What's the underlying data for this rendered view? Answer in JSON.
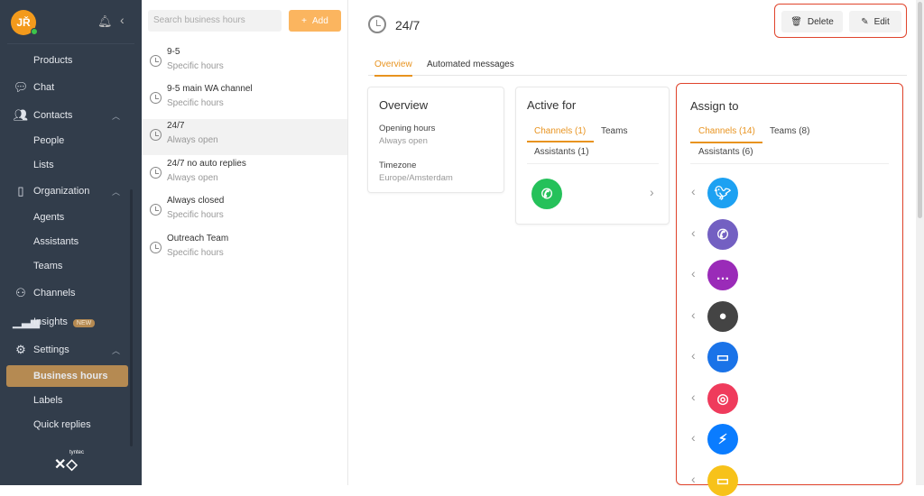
{
  "user": {
    "initials": "JŘ"
  },
  "sidebar": {
    "items": [
      {
        "label": "Products",
        "icon": "none"
      },
      {
        "label": "Chat",
        "icon": "chat-icon"
      },
      {
        "label": "Contacts",
        "icon": "contacts-icon"
      },
      {
        "label": "People"
      },
      {
        "label": "Lists"
      },
      {
        "label": "Organization",
        "icon": "building-icon"
      },
      {
        "label": "Agents"
      },
      {
        "label": "Assistants"
      },
      {
        "label": "Teams"
      },
      {
        "label": "Channels",
        "icon": "channels-icon"
      },
      {
        "label": "Insights",
        "icon": "bar-chart-icon",
        "badge": "NEW"
      },
      {
        "label": "Settings",
        "icon": "gear-icon"
      },
      {
        "label": "Business hours",
        "active": true
      },
      {
        "label": "Labels"
      },
      {
        "label": "Quick replies"
      }
    ],
    "logo": "tyntec"
  },
  "list": {
    "search_placeholder": "Search business hours",
    "add_label": "Add",
    "items": [
      {
        "title": "9-5",
        "subtitle": "Specific hours"
      },
      {
        "title": "9-5 main WA channel",
        "subtitle": "Specific hours"
      },
      {
        "title": "24/7",
        "subtitle": "Always open",
        "selected": true
      },
      {
        "title": "24/7 no auto replies",
        "subtitle": "Always open"
      },
      {
        "title": "Always closed",
        "subtitle": "Specific hours"
      },
      {
        "title": "Outreach Team",
        "subtitle": "Specific hours"
      }
    ]
  },
  "detail": {
    "title": "24/7",
    "delete_label": "Delete",
    "edit_label": "Edit",
    "tabs": [
      "Overview",
      "Automated messages"
    ],
    "overview": {
      "title": "Overview",
      "opening_label": "Opening hours",
      "opening_value": "Always open",
      "tz_label": "Timezone",
      "tz_value": "Europe/Amsterdam"
    },
    "active_for": {
      "title": "Active for",
      "tabs": [
        "Channels (1)",
        "Teams",
        "Assistants (1)"
      ],
      "channels": [
        "whatsapp"
      ]
    },
    "assign_to": {
      "title": "Assign to",
      "tabs": [
        "Channels (14)",
        "Teams (8)",
        "Assistants (6)"
      ],
      "channels": [
        {
          "name": "twitter",
          "color": "#1da1f2"
        },
        {
          "name": "viber",
          "color": "#7360c2"
        },
        {
          "name": "chat",
          "color": "#9a2bb8"
        },
        {
          "name": "sms",
          "color": "#444444"
        },
        {
          "name": "messages",
          "color": "#1a73e8"
        },
        {
          "name": "instagram",
          "color": "#ef3b5c"
        },
        {
          "name": "messenger",
          "color": "#0a7cff"
        },
        {
          "name": "sms-yellow",
          "color": "#f7c21a"
        }
      ]
    }
  },
  "colors": {
    "accent": "#e8931f",
    "sidebar": "#323d4b",
    "highlight": "#e0442c"
  }
}
